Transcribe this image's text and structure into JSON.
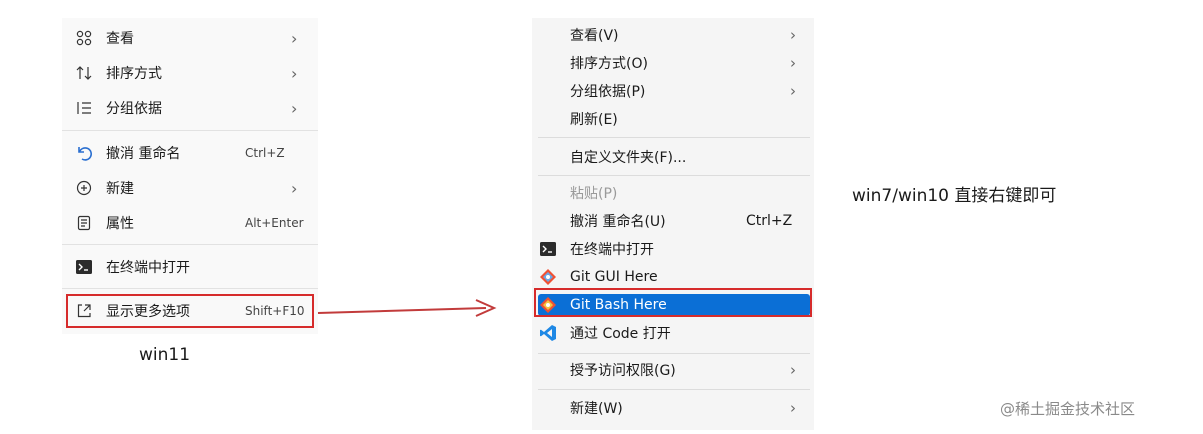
{
  "win11_menu": {
    "items": [
      {
        "label": "查看",
        "icon": "grid-icon",
        "chevron": true
      },
      {
        "label": "排序方式",
        "icon": "sort-icon",
        "chevron": true
      },
      {
        "label": "分组依据",
        "icon": "list-icon",
        "chevron": true
      },
      {
        "label": "撤消 重命名",
        "icon": "undo-icon",
        "shortcut": "Ctrl+Z"
      },
      {
        "label": "新建",
        "icon": "new-icon",
        "chevron": true
      },
      {
        "label": "属性",
        "icon": "properties-icon",
        "shortcut": "Alt+Enter"
      },
      {
        "label": "在终端中打开",
        "icon": "terminal-icon"
      },
      {
        "label": "显示更多选项",
        "icon": "more-options-icon",
        "shortcut": "Shift+F10"
      }
    ],
    "highlight_color": "#d62b2b"
  },
  "win10_menu": {
    "items": [
      {
        "label": "查看(V)",
        "chevron": true
      },
      {
        "label": "排序方式(O)",
        "chevron": true
      },
      {
        "label": "分组依据(P)",
        "chevron": true
      },
      {
        "label": "刷新(E)"
      },
      {
        "label": "自定义文件夹(F)..."
      },
      {
        "label": "粘贴(P)",
        "disabled": true
      },
      {
        "label": "撤消 重命名(U)",
        "shortcut": "Ctrl+Z"
      },
      {
        "label": "在终端中打开",
        "icon": "terminal-icon"
      },
      {
        "label": "Git GUI Here",
        "icon": "git-icon"
      },
      {
        "label": "Git Bash Here",
        "icon": "git-icon",
        "selected": true
      },
      {
        "label": "通过 Code 打开",
        "icon": "vscode-icon"
      },
      {
        "label": "授予访问权限(G)",
        "chevron": true
      },
      {
        "label": "新建(W)",
        "chevron": true
      }
    ],
    "selection_color": "#0b6fd6"
  },
  "captions": {
    "win11": "win11",
    "win10": "win7/win10 直接右键即可"
  },
  "watermark": "@稀土掘金技术社区",
  "chevron_glyph": "›"
}
